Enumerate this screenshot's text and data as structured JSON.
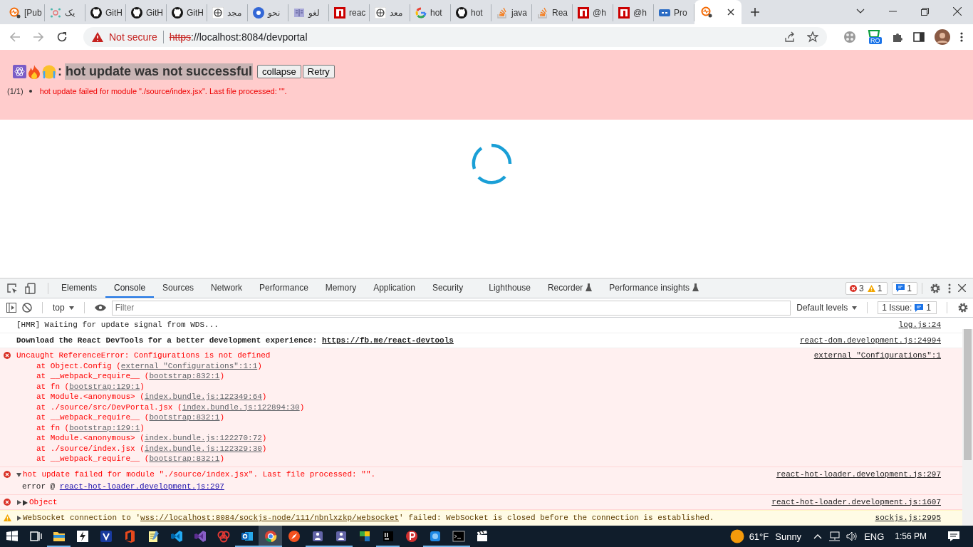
{
  "browser": {
    "tabs": [
      {
        "kind": "grafana",
        "title": "[Pub",
        "selected": false
      },
      {
        "kind": "graph",
        "title": "یک",
        "selected": false
      },
      {
        "kind": "github",
        "title": "GitH",
        "selected": false
      },
      {
        "kind": "github",
        "title": "GitH",
        "selected": false
      },
      {
        "kind": "github",
        "title": "GitH",
        "selected": false
      },
      {
        "kind": "wiki",
        "title": "مجد",
        "selected": false
      },
      {
        "kind": "dot",
        "title": "نحو",
        "selected": false
      },
      {
        "kind": "book",
        "title": "لغو",
        "selected": false
      },
      {
        "kind": "npm",
        "title": "reac",
        "selected": false
      },
      {
        "kind": "wiki",
        "title": "معد",
        "selected": false
      },
      {
        "kind": "google",
        "title": "hot",
        "selected": false
      },
      {
        "kind": "github",
        "title": "hot",
        "selected": false
      },
      {
        "kind": "stack",
        "title": "java",
        "selected": false
      },
      {
        "kind": "stack",
        "title": "Rea",
        "selected": false
      },
      {
        "kind": "npm",
        "title": "@h",
        "selected": false
      },
      {
        "kind": "npm",
        "title": "@h",
        "selected": false
      },
      {
        "kind": "chain",
        "title": "Pro",
        "selected": false
      },
      {
        "kind": "grafana",
        "selected": true
      }
    ],
    "address": {
      "security": "Not secure",
      "scheme": "https",
      "rest": "://localhost:8084/devportal"
    },
    "extension_badge": "RO"
  },
  "banner": {
    "separator": ":",
    "title": "hot update was not successful",
    "buttons": [
      "collapse",
      "Retry"
    ],
    "errors": [
      {
        "index": "(1/1)",
        "text": "hot update failed for module \"./source/index.jsx\". Last file processed: \"\"."
      }
    ]
  },
  "devtools": {
    "tabs": [
      {
        "label": "Elements",
        "selected": false,
        "experimental": false
      },
      {
        "label": "Console",
        "selected": true,
        "experimental": false
      },
      {
        "label": "Sources",
        "selected": false,
        "experimental": false
      },
      {
        "label": "Network",
        "selected": false,
        "experimental": false
      },
      {
        "label": "Performance",
        "selected": false,
        "experimental": false
      },
      {
        "label": "Memory",
        "selected": false,
        "experimental": false
      },
      {
        "label": "Application",
        "selected": false,
        "experimental": false
      },
      {
        "label": "Security",
        "selected": false,
        "experimental": false
      },
      {
        "label": "Lighthouse",
        "selected": false,
        "experimental": false
      },
      {
        "label": "Recorder",
        "selected": false,
        "experimental": true
      },
      {
        "label": "Performance insights",
        "selected": false,
        "experimental": true
      }
    ],
    "counts": {
      "errors": "3",
      "warnings": "1",
      "messages": "1"
    },
    "toolbar": {
      "context": "top",
      "filter_placeholder": "Filter",
      "levels": "Default levels",
      "issues_label": "1 Issue:",
      "issues_count": "1"
    },
    "messages": [
      {
        "kind": "log",
        "bold": false,
        "text": [
          {
            "text": "[HMR] Waiting for update signal from WDS..."
          }
        ],
        "source": "log.js:24"
      },
      {
        "kind": "log",
        "bold": true,
        "text": [
          {
            "text": "Download the React DevTools for a better development experience: "
          },
          {
            "text": "https://fb.me/react-devtools",
            "link": true
          }
        ],
        "source": "react-dom.development.js:24994"
      },
      {
        "kind": "error",
        "bold": false,
        "text": [
          {
            "text": "Uncaught ReferenceError: Configurations is not defined"
          }
        ],
        "source": "external \"Configurations\":1",
        "stack": [
          [
            {
              "text": "at Object.Config ("
            },
            {
              "text": "external \"Configurations\":1:1",
              "link": true
            },
            {
              "text": ")"
            }
          ],
          [
            {
              "text": "at __webpack_require__ ("
            },
            {
              "text": "bootstrap:832:1",
              "link": true
            },
            {
              "text": ")"
            }
          ],
          [
            {
              "text": "at fn ("
            },
            {
              "text": "bootstrap:129:1",
              "link": true
            },
            {
              "text": ")"
            }
          ],
          [
            {
              "text": "at Module.<anonymous> ("
            },
            {
              "text": "index.bundle.js:122349:64",
              "link": true
            },
            {
              "text": ")"
            }
          ],
          [
            {
              "text": "at ./source/src/DevPortal.jsx ("
            },
            {
              "text": "index.bundle.js:122894:30",
              "link": true
            },
            {
              "text": ")"
            }
          ],
          [
            {
              "text": "at __webpack_require__ ("
            },
            {
              "text": "bootstrap:832:1",
              "link": true
            },
            {
              "text": ")"
            }
          ],
          [
            {
              "text": "at fn ("
            },
            {
              "text": "bootstrap:129:1",
              "link": true
            },
            {
              "text": ")"
            }
          ],
          [
            {
              "text": "at Module.<anonymous> ("
            },
            {
              "text": "index.bundle.js:122270:72",
              "link": true
            },
            {
              "text": ")"
            }
          ],
          [
            {
              "text": "at ./source/index.jsx ("
            },
            {
              "text": "index.bundle.js:122329:30",
              "link": true
            },
            {
              "text": ")"
            }
          ],
          [
            {
              "text": "at __webpack_require__ ("
            },
            {
              "text": "bootstrap:832:1",
              "link": true
            },
            {
              "text": ")"
            }
          ]
        ]
      },
      {
        "kind": "error",
        "bold": false,
        "expanded": true,
        "text": [
          {
            "text": "hot update failed for module \"./source/index.jsx\". Last file processed: \"\"."
          }
        ],
        "source": "react-hot-loader.development.js:297",
        "detail": [
          {
            "text": "error @ "
          },
          {
            "text": "react-hot-loader.development.js:297",
            "link": true
          }
        ]
      },
      {
        "kind": "error",
        "bold": false,
        "expanded": false,
        "object": true,
        "text": [
          {
            "text": "Object"
          }
        ],
        "source": "react-hot-loader.development.js:1607"
      },
      {
        "kind": "warning",
        "bold": false,
        "expanded": false,
        "text": [
          {
            "text": "WebSocket connection to '"
          },
          {
            "text": "wss://localhost:8084/sockjs-node/111/nbnlxzkp/websocket",
            "link": true
          },
          {
            "text": "' failed: WebSocket is closed before the connection is established."
          }
        ],
        "source": "sockjs.js:2995"
      }
    ]
  },
  "taskbar": {
    "apps": [
      {
        "kind": "start",
        "running": false,
        "active": false
      },
      {
        "kind": "taskview",
        "running": false,
        "active": false
      },
      {
        "kind": "folder",
        "running": true,
        "active": false
      },
      {
        "kind": "bolt",
        "running": false,
        "active": false
      },
      {
        "kind": "vbox",
        "running": false,
        "active": false
      },
      {
        "kind": "office",
        "running": false,
        "active": false
      },
      {
        "kind": "notepad",
        "running": false,
        "active": false
      },
      {
        "kind": "vscode",
        "running": false,
        "active": false
      },
      {
        "kind": "vstudio",
        "running": false,
        "active": false
      },
      {
        "kind": "redknot",
        "running": false,
        "active": false
      },
      {
        "kind": "outlook",
        "running": true,
        "active": false
      },
      {
        "kind": "chrome",
        "running": true,
        "active": true
      },
      {
        "kind": "compass",
        "running": false,
        "active": false
      },
      {
        "kind": "teams",
        "running": true,
        "active": false
      },
      {
        "kind": "teams",
        "running": true,
        "active": false
      },
      {
        "kind": "puzzle",
        "running": false,
        "active": false
      },
      {
        "kind": "intellij",
        "running": true,
        "active": false
      },
      {
        "kind": "pred",
        "running": false,
        "active": false
      },
      {
        "kind": "bluebox",
        "running": true,
        "active": false
      },
      {
        "kind": "cmd",
        "running": true,
        "active": false
      },
      {
        "kind": "clapper",
        "running": false,
        "active": false
      }
    ],
    "weather": {
      "temperature": "61°F",
      "condition": "Sunny"
    },
    "language": "ENG",
    "time": "1:56 PM"
  }
}
